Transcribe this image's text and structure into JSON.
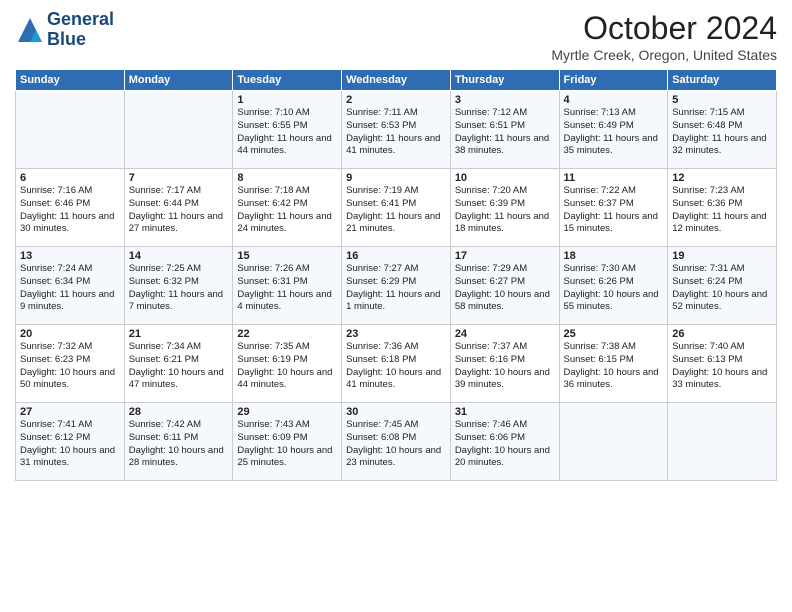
{
  "header": {
    "logo_line1": "General",
    "logo_line2": "Blue",
    "month": "October 2024",
    "location": "Myrtle Creek, Oregon, United States"
  },
  "days_of_week": [
    "Sunday",
    "Monday",
    "Tuesday",
    "Wednesday",
    "Thursday",
    "Friday",
    "Saturday"
  ],
  "weeks": [
    [
      {
        "day": "",
        "content": ""
      },
      {
        "day": "",
        "content": ""
      },
      {
        "day": "1",
        "content": "Sunrise: 7:10 AM\nSunset: 6:55 PM\nDaylight: 11 hours\nand 44 minutes."
      },
      {
        "day": "2",
        "content": "Sunrise: 7:11 AM\nSunset: 6:53 PM\nDaylight: 11 hours\nand 41 minutes."
      },
      {
        "day": "3",
        "content": "Sunrise: 7:12 AM\nSunset: 6:51 PM\nDaylight: 11 hours\nand 38 minutes."
      },
      {
        "day": "4",
        "content": "Sunrise: 7:13 AM\nSunset: 6:49 PM\nDaylight: 11 hours\nand 35 minutes."
      },
      {
        "day": "5",
        "content": "Sunrise: 7:15 AM\nSunset: 6:48 PM\nDaylight: 11 hours\nand 32 minutes."
      }
    ],
    [
      {
        "day": "6",
        "content": "Sunrise: 7:16 AM\nSunset: 6:46 PM\nDaylight: 11 hours\nand 30 minutes."
      },
      {
        "day": "7",
        "content": "Sunrise: 7:17 AM\nSunset: 6:44 PM\nDaylight: 11 hours\nand 27 minutes."
      },
      {
        "day": "8",
        "content": "Sunrise: 7:18 AM\nSunset: 6:42 PM\nDaylight: 11 hours\nand 24 minutes."
      },
      {
        "day": "9",
        "content": "Sunrise: 7:19 AM\nSunset: 6:41 PM\nDaylight: 11 hours\nand 21 minutes."
      },
      {
        "day": "10",
        "content": "Sunrise: 7:20 AM\nSunset: 6:39 PM\nDaylight: 11 hours\nand 18 minutes."
      },
      {
        "day": "11",
        "content": "Sunrise: 7:22 AM\nSunset: 6:37 PM\nDaylight: 11 hours\nand 15 minutes."
      },
      {
        "day": "12",
        "content": "Sunrise: 7:23 AM\nSunset: 6:36 PM\nDaylight: 11 hours\nand 12 minutes."
      }
    ],
    [
      {
        "day": "13",
        "content": "Sunrise: 7:24 AM\nSunset: 6:34 PM\nDaylight: 11 hours\nand 9 minutes."
      },
      {
        "day": "14",
        "content": "Sunrise: 7:25 AM\nSunset: 6:32 PM\nDaylight: 11 hours\nand 7 minutes."
      },
      {
        "day": "15",
        "content": "Sunrise: 7:26 AM\nSunset: 6:31 PM\nDaylight: 11 hours\nand 4 minutes."
      },
      {
        "day": "16",
        "content": "Sunrise: 7:27 AM\nSunset: 6:29 PM\nDaylight: 11 hours\nand 1 minute."
      },
      {
        "day": "17",
        "content": "Sunrise: 7:29 AM\nSunset: 6:27 PM\nDaylight: 10 hours\nand 58 minutes."
      },
      {
        "day": "18",
        "content": "Sunrise: 7:30 AM\nSunset: 6:26 PM\nDaylight: 10 hours\nand 55 minutes."
      },
      {
        "day": "19",
        "content": "Sunrise: 7:31 AM\nSunset: 6:24 PM\nDaylight: 10 hours\nand 52 minutes."
      }
    ],
    [
      {
        "day": "20",
        "content": "Sunrise: 7:32 AM\nSunset: 6:23 PM\nDaylight: 10 hours\nand 50 minutes."
      },
      {
        "day": "21",
        "content": "Sunrise: 7:34 AM\nSunset: 6:21 PM\nDaylight: 10 hours\nand 47 minutes."
      },
      {
        "day": "22",
        "content": "Sunrise: 7:35 AM\nSunset: 6:19 PM\nDaylight: 10 hours\nand 44 minutes."
      },
      {
        "day": "23",
        "content": "Sunrise: 7:36 AM\nSunset: 6:18 PM\nDaylight: 10 hours\nand 41 minutes."
      },
      {
        "day": "24",
        "content": "Sunrise: 7:37 AM\nSunset: 6:16 PM\nDaylight: 10 hours\nand 39 minutes."
      },
      {
        "day": "25",
        "content": "Sunrise: 7:38 AM\nSunset: 6:15 PM\nDaylight: 10 hours\nand 36 minutes."
      },
      {
        "day": "26",
        "content": "Sunrise: 7:40 AM\nSunset: 6:13 PM\nDaylight: 10 hours\nand 33 minutes."
      }
    ],
    [
      {
        "day": "27",
        "content": "Sunrise: 7:41 AM\nSunset: 6:12 PM\nDaylight: 10 hours\nand 31 minutes."
      },
      {
        "day": "28",
        "content": "Sunrise: 7:42 AM\nSunset: 6:11 PM\nDaylight: 10 hours\nand 28 minutes."
      },
      {
        "day": "29",
        "content": "Sunrise: 7:43 AM\nSunset: 6:09 PM\nDaylight: 10 hours\nand 25 minutes."
      },
      {
        "day": "30",
        "content": "Sunrise: 7:45 AM\nSunset: 6:08 PM\nDaylight: 10 hours\nand 23 minutes."
      },
      {
        "day": "31",
        "content": "Sunrise: 7:46 AM\nSunset: 6:06 PM\nDaylight: 10 hours\nand 20 minutes."
      },
      {
        "day": "",
        "content": ""
      },
      {
        "day": "",
        "content": ""
      }
    ]
  ]
}
